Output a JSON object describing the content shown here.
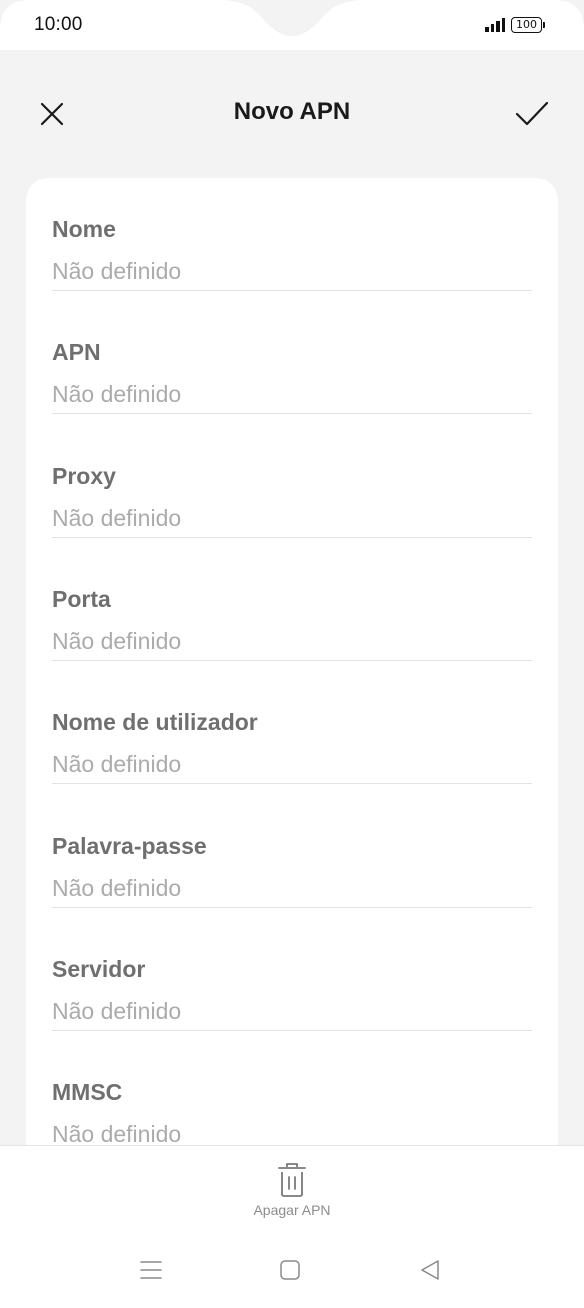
{
  "status_bar": {
    "time": "10:00",
    "battery": "100"
  },
  "header": {
    "title": "Novo APN",
    "close_icon": "close-icon",
    "confirm_icon": "checkmark-icon"
  },
  "fields": [
    {
      "label": "Nome",
      "value": "Não definido"
    },
    {
      "label": "APN",
      "value": "Não definido"
    },
    {
      "label": "Proxy",
      "value": "Não definido"
    },
    {
      "label": "Porta",
      "value": "Não definido"
    },
    {
      "label": "Nome de utilizador",
      "value": "Não definido"
    },
    {
      "label": "Palavra-passe",
      "value": "Não definido"
    },
    {
      "label": "Servidor",
      "value": "Não definido"
    },
    {
      "label": "MMSC",
      "value": "Não definido"
    }
  ],
  "bottom_bar": {
    "delete_label": "Apagar APN",
    "delete_icon": "trash-icon"
  },
  "nav_bar": {
    "menu_icon": "menu-icon",
    "home_icon": "home-icon",
    "back_icon": "back-icon"
  },
  "colors": {
    "background": "#f3f3f3",
    "card": "#ffffff",
    "label": "#6f6f6f",
    "value": "#ababab"
  }
}
